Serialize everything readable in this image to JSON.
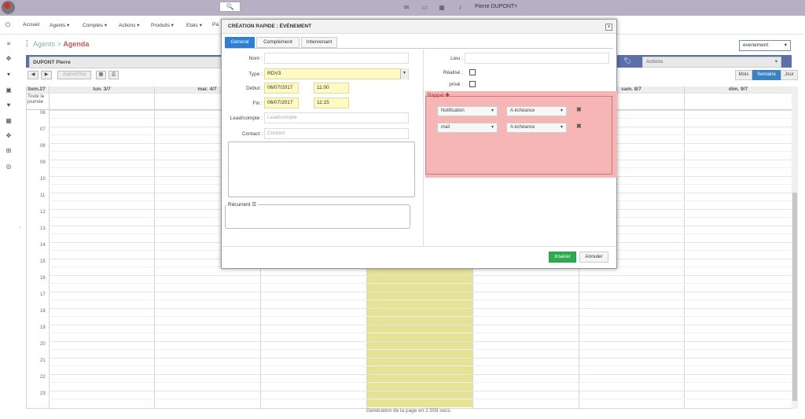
{
  "topbar": {
    "search_icon": "🔍",
    "user": "Pierre DUPONT",
    "icons": [
      "mail-icon",
      "inbox-icon",
      "calendar-icon",
      "bell-icon"
    ]
  },
  "menu": [
    "Accueil",
    "Agents ▾",
    "Comptes ▾",
    "Actions ▾",
    "Produits ▾",
    "Etats ▾",
    "Pa"
  ],
  "breadcrumb": {
    "root": "Agents",
    "sep": ">",
    "current": "Agenda"
  },
  "event_select": "evenement",
  "agent_name": "DUPONT Pierre",
  "actions_select": "Actions",
  "toolbar": {
    "today": "Aujourd'hui"
  },
  "views": [
    "Mois",
    "Semaine",
    "Jour"
  ],
  "calendar": {
    "week_label": "Sem.27",
    "all_day": "Toute la journée",
    "days": [
      "lun. 3/7",
      "mar. 4/7",
      "sam. 8/7",
      "dim. 9/7"
    ],
    "hours": [
      "06",
      "07",
      "08",
      "09",
      "10",
      "11",
      "12",
      "13",
      "15",
      "16",
      "17",
      "18",
      "19",
      "20",
      "21",
      "22",
      "23"
    ],
    "hours_full": [
      "06",
      "07",
      "08",
      "09",
      "10",
      "11",
      "12",
      "13",
      "14",
      "15",
      "16",
      "17",
      "18",
      "19",
      "20",
      "21",
      "22",
      "23"
    ]
  },
  "footer": "Génération de la page en 2.559 secs.",
  "modal": {
    "title": "CRÉATION RAPIDE : ÉVÉNEMENT",
    "close": "×",
    "tabs": [
      "Général",
      "Complément",
      "Intervenant"
    ],
    "nom_label": "Nom :",
    "type_label": "Type :",
    "type_value": "RDV3",
    "debut_label": "Début :",
    "debut_date": "06/07/2017",
    "debut_time": "11:00",
    "fin_label": "Fin :",
    "fin_date": "06/07/2017",
    "fin_time": "11:15",
    "lead_label": "Lead/compte :",
    "lead_placeholder": "Lead/compte",
    "contact_label": "Contact :",
    "contact_placeholder": "Contact",
    "recurrent_label": "Récurrent",
    "lieu_label": "Lieu :",
    "realise_label": "Réalisé :",
    "prive_label": "privé :",
    "rappel_label": "Rappel",
    "rappels": [
      {
        "type": "Notification",
        "when": "A échéance"
      },
      {
        "type": "mail",
        "when": "A échéance"
      }
    ],
    "insert": "Insérer",
    "cancel": "Annuler"
  }
}
